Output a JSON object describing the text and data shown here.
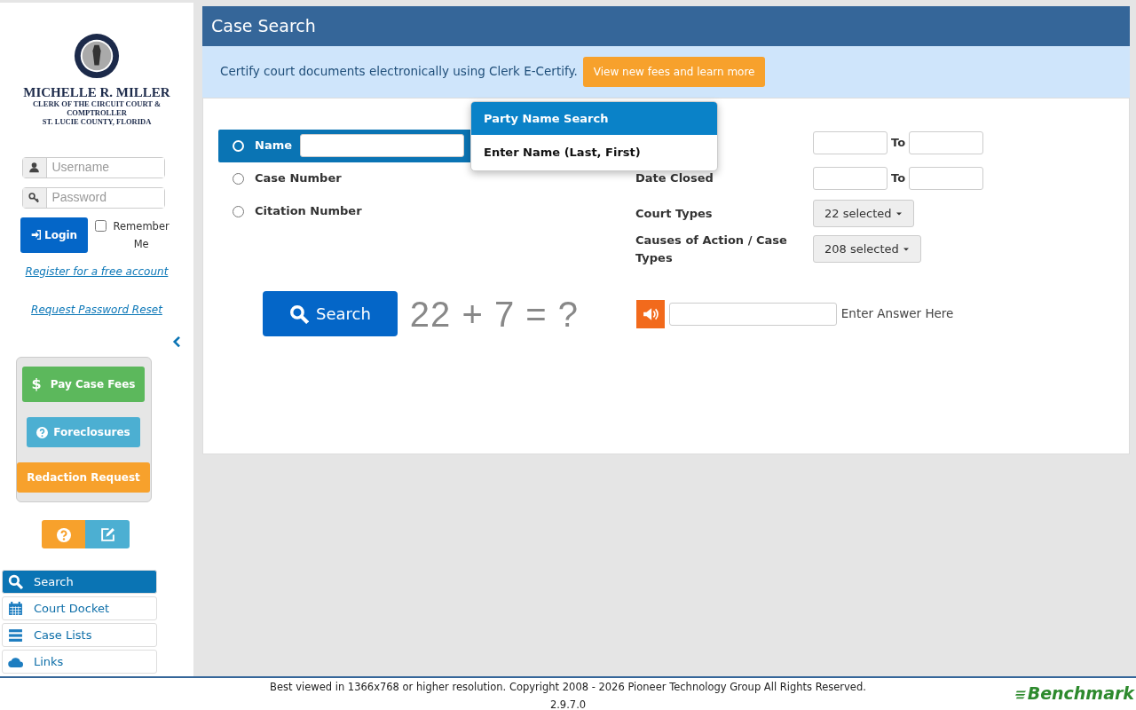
{
  "sidebar": {
    "logo": {
      "name": "MICHELLE R. MILLER",
      "subtitle": "CLERK OF THE CIRCUIT COURT & COMPTROLLER",
      "county": "ST. LUCIE COUNTY, FLORIDA"
    },
    "login": {
      "username_placeholder": "Username",
      "password_placeholder": "Password",
      "login_button": "Login",
      "remember": {
        "label": "Remember Me",
        "checked": false
      }
    },
    "links": [
      "Register for a free account",
      "Request Password Reset"
    ],
    "quick_buttons": [
      {
        "label": "Pay Case Fees",
        "kind": "pay",
        "symbol": "$"
      },
      {
        "label": "Foreclosures",
        "kind": "info"
      },
      {
        "label": "Redaction Request",
        "kind": "warning"
      }
    ],
    "nav": [
      {
        "label": "Search",
        "kind": "search",
        "selected": true
      },
      {
        "label": "Court Docket",
        "kind": "calendar",
        "selected": false
      },
      {
        "label": "Case Lists",
        "kind": "list",
        "selected": false
      },
      {
        "label": "Links",
        "kind": "cloud",
        "selected": false
      }
    ]
  },
  "header": {
    "title": "Case Search"
  },
  "notice": {
    "text": "Certify court documents electronically using Clerk E-Certify.",
    "button": "View new fees and learn more"
  },
  "search_types": [
    {
      "label": "Name",
      "selected": true
    },
    {
      "label": "Case Number",
      "selected": false
    },
    {
      "label": "Citation Number",
      "selected": false
    }
  ],
  "popover": {
    "title": "Party Name Search",
    "text": "Enter Name (Last, First)"
  },
  "date_ranges": [
    {
      "to": "To"
    },
    {
      "label": "Date Closed",
      "to": "To"
    }
  ],
  "selects": [
    {
      "label": "Court Types",
      "value": "22 selected"
    },
    {
      "label": "Causes of Action / Case Types",
      "value": "208 selected"
    }
  ],
  "search_button": "Search",
  "captcha": {
    "question": "22 + 7 = ?",
    "hint": "Enter Answer Here"
  },
  "footer": {
    "copyright": "Best viewed in 1366x768 or higher resolution. Copyright 2008 - 2026 Pioneer Technology Group All Rights Reserved.",
    "version": "2.9.7.0",
    "brand": "Benchmark"
  }
}
